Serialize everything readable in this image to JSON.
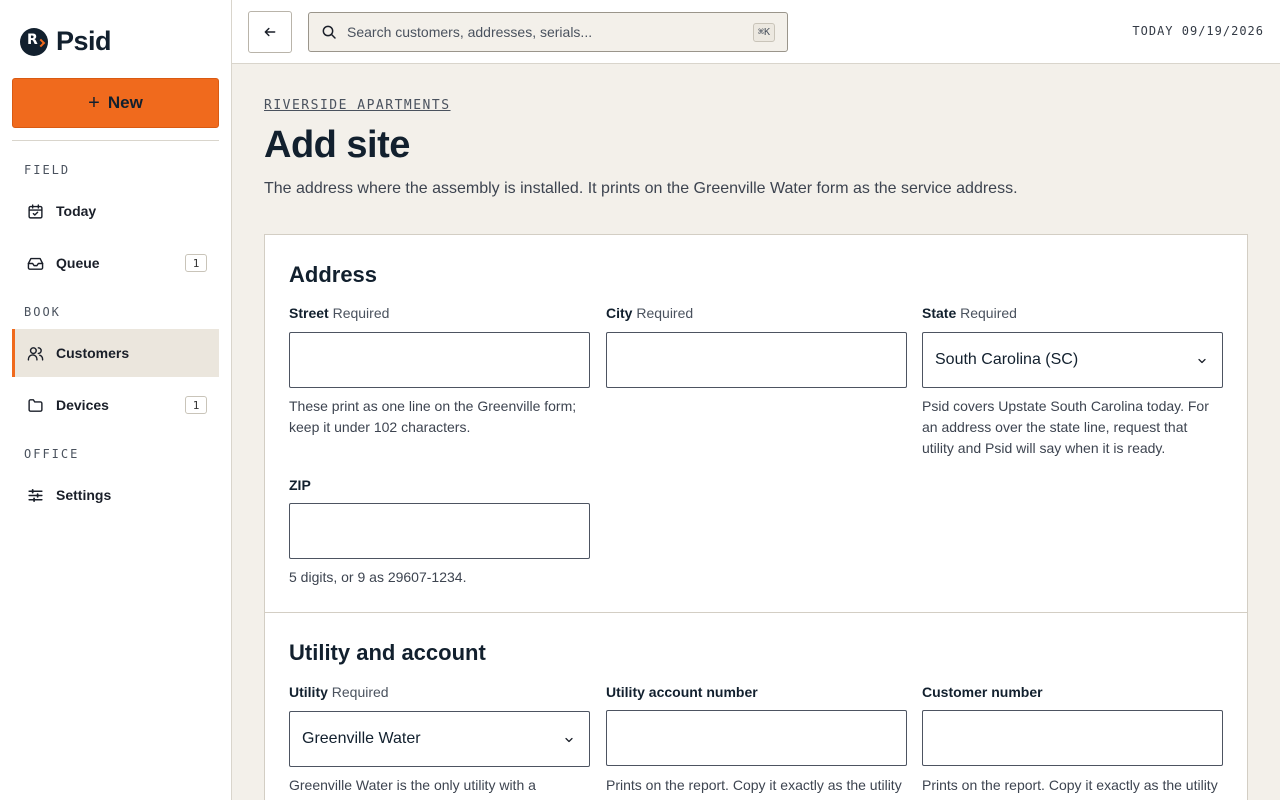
{
  "brand": {
    "name": "Psid",
    "logo_letter": "R"
  },
  "colors": {
    "accent": "#f06a1d",
    "ink": "#12202e",
    "background": "#f3f0ea"
  },
  "sidebar": {
    "new_label": "New",
    "sections": {
      "field": "FIELD",
      "book": "BOOK",
      "office": "OFFICE"
    },
    "items": {
      "today": {
        "label": "Today",
        "icon": "calendar-check-icon"
      },
      "queue": {
        "label": "Queue",
        "icon": "inbox-icon",
        "badge": "1"
      },
      "customers": {
        "label": "Customers",
        "icon": "users-icon",
        "active": true
      },
      "devices": {
        "label": "Devices",
        "icon": "folder-icon",
        "badge": "1"
      },
      "settings": {
        "label": "Settings",
        "icon": "sliders-icon"
      }
    }
  },
  "topbar": {
    "search_placeholder": "Search customers, addresses, serials...",
    "shortcut": "⌘K",
    "today": "TODAY 09/19/2026"
  },
  "page": {
    "breadcrumb": "RIVERSIDE APARTMENTS",
    "title": "Add site",
    "subtitle": "The address where the assembly is installed. It prints on the Greenville Water form as the service address."
  },
  "address": {
    "heading": "Address",
    "required_text": "Required",
    "street": {
      "label": "Street",
      "value": "",
      "help": "These print as one line on the Greenville form; keep it under 102 characters."
    },
    "city": {
      "label": "City",
      "value": ""
    },
    "state": {
      "label": "State",
      "value": "South Carolina (SC)",
      "help": "Psid covers Upstate South Carolina today. For an address over the state line, request that utility and Psid will say when it is ready."
    },
    "zip": {
      "label": "ZIP",
      "value": "",
      "help": "5 digits, or 9 as 29607-1234."
    }
  },
  "utility": {
    "heading": "Utility and account",
    "required_text": "Required",
    "utility": {
      "label": "Utility",
      "value": "Greenville Water",
      "help": "Greenville Water is the only utility with a"
    },
    "account": {
      "label": "Utility account number",
      "value": "",
      "help": "Prints on the report. Copy it exactly as the utility"
    },
    "customer": {
      "label": "Customer number",
      "value": "",
      "help": "Prints on the report. Copy it exactly as the utility"
    }
  }
}
